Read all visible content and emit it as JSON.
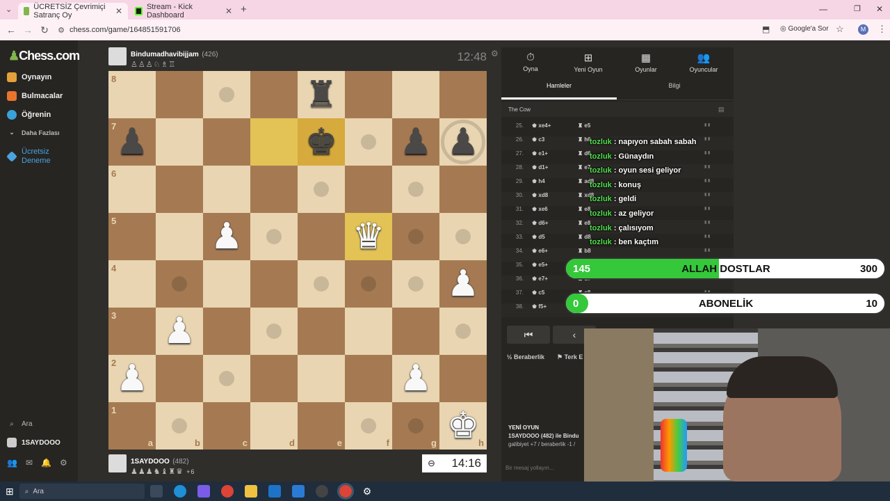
{
  "browser": {
    "tabs": [
      {
        "label": "ÜCRETSİZ Çevrimiçi Satranç Oy"
      },
      {
        "label": "Stream - Kick Dashboard"
      }
    ],
    "new_tab": "+",
    "url": "chess.com/game/164851591706",
    "google_label": "Google'a Sor",
    "profile_initial": "M"
  },
  "sidebar": {
    "logo": "Chess.com",
    "items": [
      {
        "label": "Oynayın"
      },
      {
        "label": "Bulmacalar"
      },
      {
        "label": "Öğrenin"
      },
      {
        "label": "Daha Fazlası"
      },
      {
        "label": "Ücretsiz Deneme"
      }
    ],
    "search_label": "Ara",
    "username": "1SAYDOOO"
  },
  "top_player": {
    "name": "Bindumadhavibijjam",
    "rating": "(426)",
    "clock": "12:48"
  },
  "bottom_player": {
    "name": "1SAYDOOO",
    "rating": "(482)",
    "material": "+6",
    "clock": "14:16"
  },
  "board": {
    "ranks": [
      "8",
      "7",
      "6",
      "5",
      "4",
      "3",
      "2",
      "1"
    ],
    "files": [
      "a",
      "b",
      "c",
      "d",
      "e",
      "f",
      "g",
      "h"
    ]
  },
  "panel": {
    "tabs": [
      {
        "label": "Oyna",
        "icon": "stopwatch-icon"
      },
      {
        "label": "Yeni Oyun",
        "icon": "plus-icon"
      },
      {
        "label": "Oyunlar",
        "icon": "board-icon"
      },
      {
        "label": "Oyuncular",
        "icon": "users-icon"
      }
    ],
    "subtabs": [
      "Hamleler",
      "Bilgi"
    ],
    "opening": "The Cow",
    "moves": [
      {
        "n": "25.",
        "w": "xe4+",
        "b": "e5"
      },
      {
        "n": "26.",
        "w": "c3",
        "b": "h6"
      },
      {
        "n": "27.",
        "w": "e1+",
        "b": "d6"
      },
      {
        "n": "28.",
        "w": "d1+",
        "b": "e7"
      },
      {
        "n": "29.",
        "w": "h4",
        "b": "ad8"
      },
      {
        "n": "30.",
        "w": "xd8",
        "b": "xd8"
      },
      {
        "n": "31.",
        "w": "xe6",
        "b": "e8"
      },
      {
        "n": "32.",
        "w": "d6+",
        "b": "e8"
      },
      {
        "n": "33.",
        "w": "d5",
        "b": "d8"
      },
      {
        "n": "34.",
        "w": "e6+",
        "b": "b8"
      },
      {
        "n": "35.",
        "w": "e5+",
        "b": "c8"
      },
      {
        "n": "36.",
        "w": "e7+",
        "b": "d7"
      },
      {
        "n": "37.",
        "w": "c5",
        "b": "e8"
      },
      {
        "n": "38.",
        "w": "f5+",
        "b": "e7"
      }
    ],
    "draw_label": "Beraberlik",
    "resign_label": "Terk E",
    "new_game_title": "YENİ OYUN",
    "new_game_text": "1SAYDOOO (482) ile Bindu",
    "new_game_text2": "galibiyet +7 / beraberlik -1 /",
    "message_placeholder": "Bir mesaj yollayın..."
  },
  "chat": [
    {
      "user": "tozluk",
      "msg": ": napıyon sabah sabah"
    },
    {
      "user": "tozluk",
      "msg": ": Günaydın"
    },
    {
      "user": "tozluk",
      "msg": ": oyun sesi geliyor"
    },
    {
      "user": "tozluk",
      "msg": ": konuş"
    },
    {
      "user": "tozluk",
      "msg": ": geldi"
    },
    {
      "user": "tozluk",
      "msg": ": az geliyor"
    },
    {
      "user": "tozluk",
      "msg": ": çalısıyom"
    },
    {
      "user": "tozluk",
      "msg": ": ben kaçtım"
    }
  ],
  "goals": [
    {
      "current": "145",
      "label": "ALLAH DOSTLAR",
      "target": "300",
      "progress": 0.48
    },
    {
      "current": "0",
      "label": "ABONELİK",
      "target": "10",
      "progress": 0.0
    }
  ],
  "taskbar": {
    "search_label": "Ara"
  },
  "colors": {
    "accent_green": "#35c83a",
    "chat_user": "#4fe04a",
    "light_square": "#e9d5b1",
    "dark_square": "#a57a52"
  }
}
